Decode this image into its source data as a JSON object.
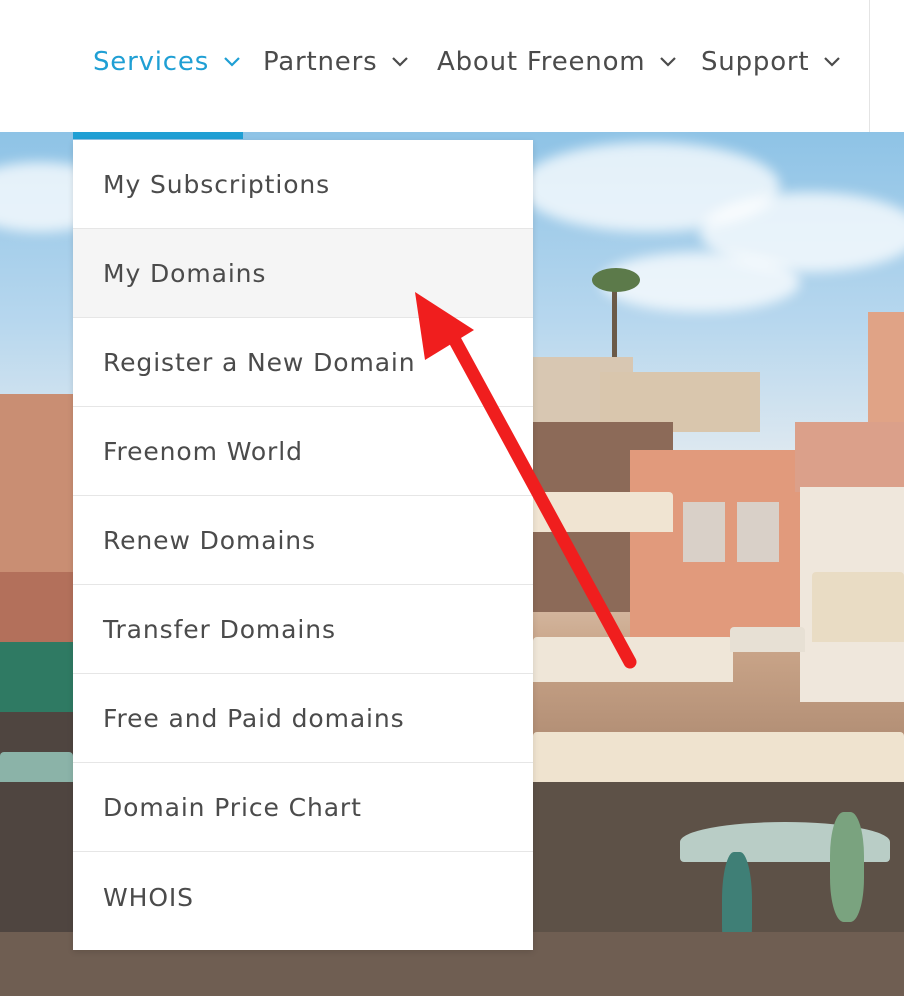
{
  "nav": {
    "items": [
      {
        "label": "Services",
        "active": true
      },
      {
        "label": "Partners",
        "active": false
      },
      {
        "label": "About Freenom",
        "active": false
      },
      {
        "label": "Support",
        "active": false
      }
    ]
  },
  "dropdown": {
    "items": [
      {
        "label": "My Subscriptions"
      },
      {
        "label": "My Domains",
        "highlighted": true
      },
      {
        "label": "Register a New Domain"
      },
      {
        "label": "Freenom World"
      },
      {
        "label": "Renew Domains"
      },
      {
        "label": "Transfer Domains"
      },
      {
        "label": "Free and Paid domains"
      },
      {
        "label": "Domain Price Chart"
      },
      {
        "label": "WHOIS"
      }
    ]
  },
  "colors": {
    "accent": "#1f9fd4",
    "text": "#4b4b4b",
    "annotation_arrow": "#f01e1e"
  },
  "icons": {
    "nav_chevron": "chevron-down-icon",
    "annotation": "red-arrow-annotation"
  }
}
